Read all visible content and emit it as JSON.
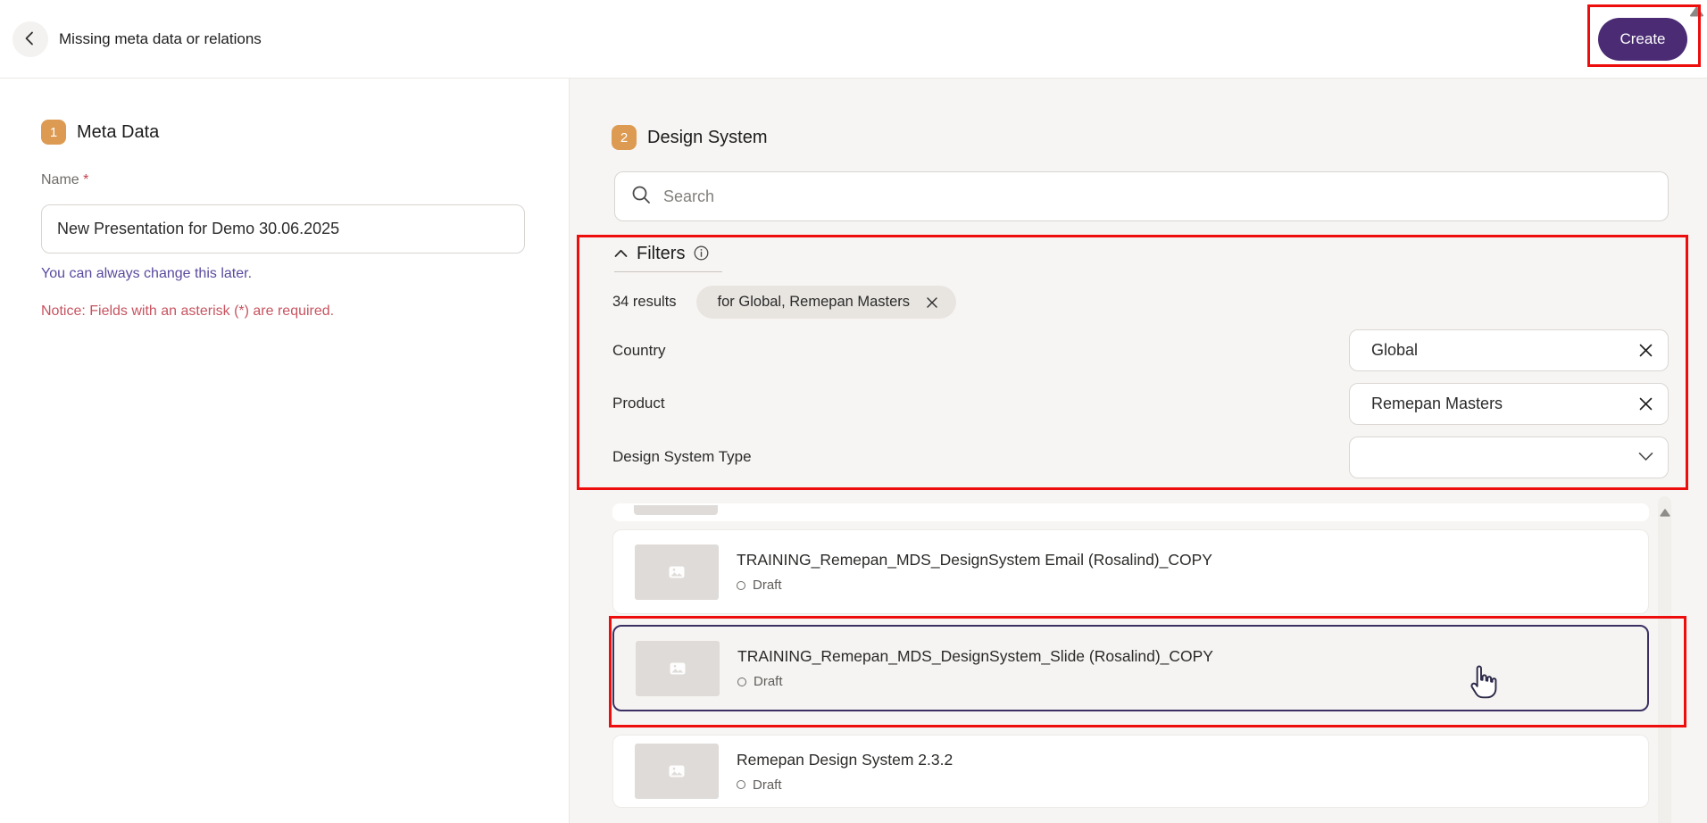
{
  "topbar": {
    "title": "Missing meta data or relations",
    "create_label": "Create"
  },
  "meta": {
    "step": "1",
    "title": "Meta Data",
    "name_label": "Name",
    "required_mark": "*",
    "name_value": "New Presentation for Demo 30.06.2025",
    "hint": "You can always change this later.",
    "notice": "Notice: Fields with an asterisk (*) are required."
  },
  "design_system": {
    "step": "2",
    "title": "Design System",
    "search_placeholder": "Search",
    "filters": {
      "title": "Filters",
      "results_count": "34 results",
      "active_chip": "for Global, Remepan Masters",
      "rows": [
        {
          "label": "Country",
          "value": "Global"
        },
        {
          "label": "Product",
          "value": "Remepan Masters"
        },
        {
          "label": "Design System Type",
          "value": ""
        }
      ]
    },
    "items": [
      {
        "title": "TRAINING_Remepan_MDS_DesignSystem Email (Rosalind)_COPY",
        "status": "Draft"
      },
      {
        "title": "TRAINING_Remepan_MDS_DesignSystem_Slide (Rosalind)_COPY",
        "status": "Draft"
      },
      {
        "title": "Remepan Design System 2.3.2",
        "status": "Draft"
      }
    ]
  },
  "colors": {
    "accent_purple": "#4a2b74",
    "step_badge_orange": "#dd9a52",
    "annotation_red": "#ee0d0d",
    "selected_border": "#3b2f63",
    "hint_purple": "#5a4a9e",
    "notice_red": "#c75460"
  }
}
